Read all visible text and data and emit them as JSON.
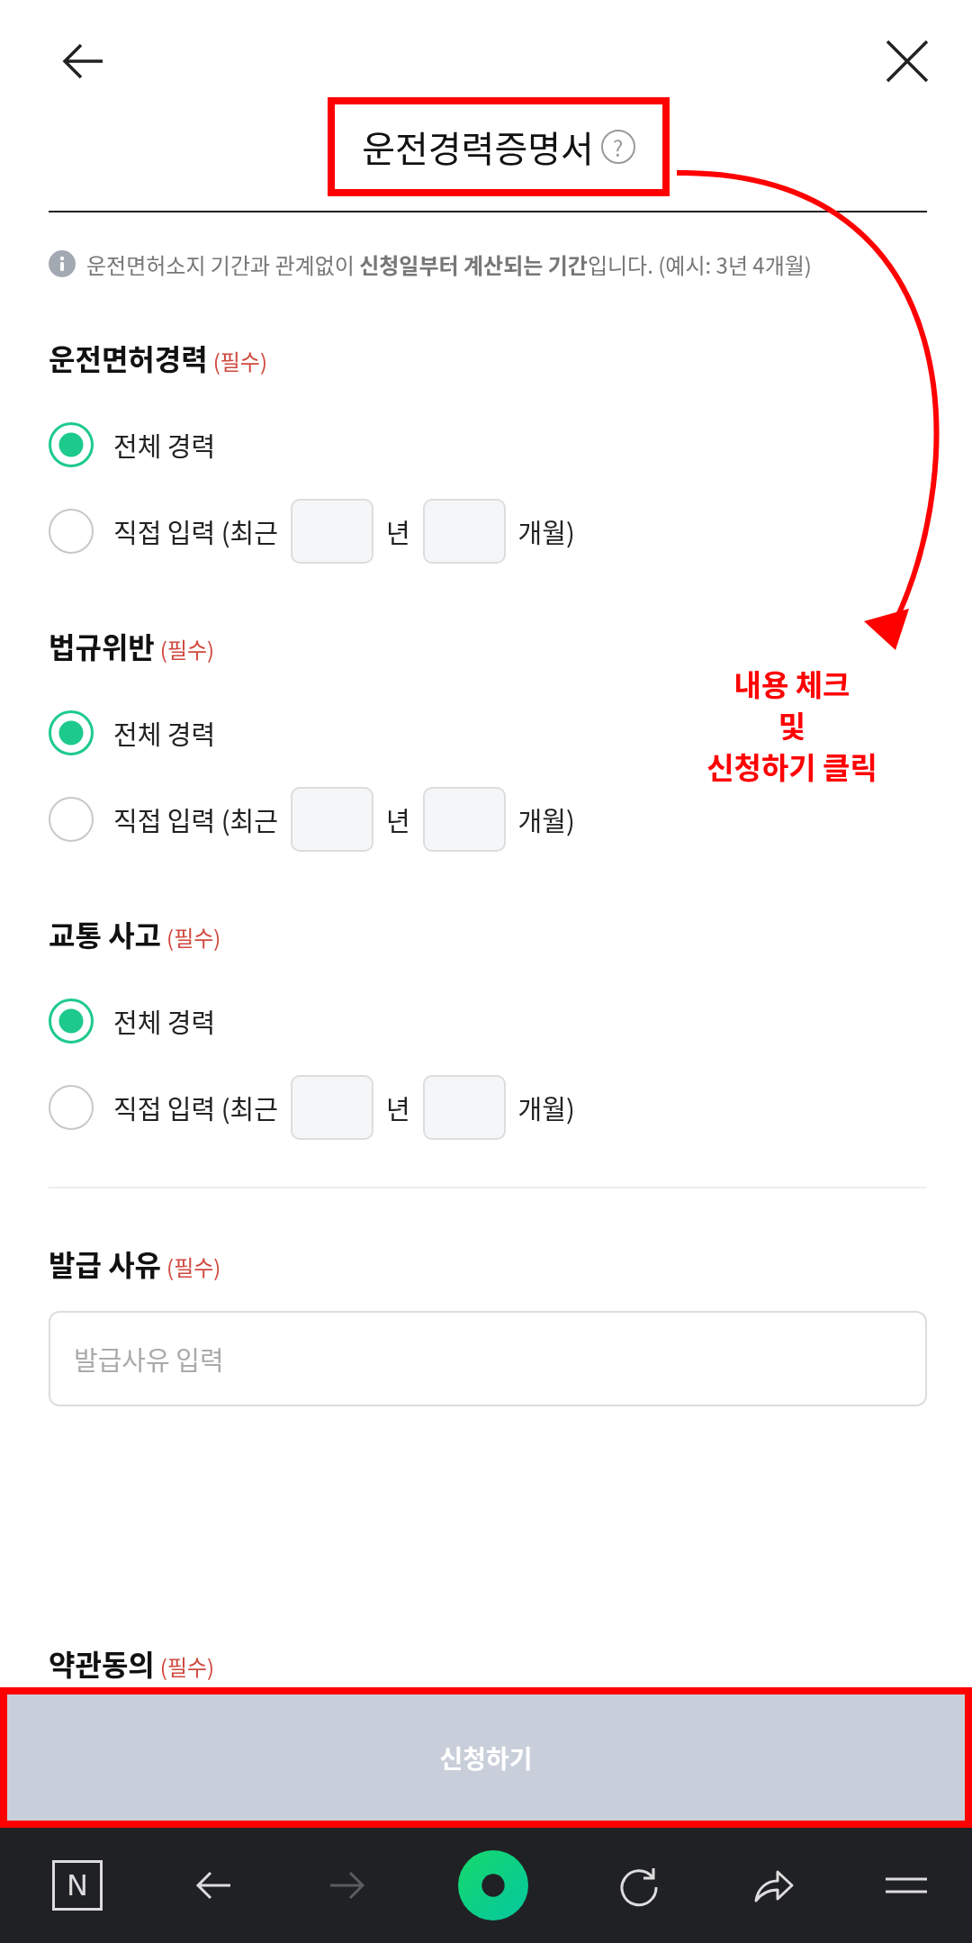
{
  "header": {
    "title": "운전경력증명서",
    "help_icon": "?"
  },
  "info": "운전면허소지 기간과 관계없이 **신청일부터 계산되는 기간**입니다. (예시: 3년 4개월)",
  "sections": [
    {
      "title": "운전면허경력",
      "required": "(필수)",
      "options": [
        {
          "kind": "plain",
          "label": "전체 경력",
          "selected": true
        },
        {
          "kind": "range",
          "label": "직접 입력 (최근",
          "fields": [
            {
              "unit": "년"
            },
            {
              "unit": "개월)"
            }
          ],
          "selected": false
        }
      ]
    },
    {
      "title": "법규위반",
      "required": "(필수)",
      "options": [
        {
          "kind": "plain",
          "label": "전체 경력",
          "selected": true
        },
        {
          "kind": "range",
          "label": "직접 입력 (최근",
          "fields": [
            {
              "unit": "년"
            },
            {
              "unit": "개월)"
            }
          ],
          "selected": false
        }
      ]
    },
    {
      "title": "교통 사고",
      "required": "(필수)",
      "options": [
        {
          "kind": "plain",
          "label": "전체 경력",
          "selected": true
        },
        {
          "kind": "range",
          "label": "직접 입력 (최근",
          "fields": [
            {
              "unit": "년"
            },
            {
              "unit": "개월)"
            }
          ],
          "selected": false
        }
      ]
    }
  ],
  "reason": {
    "title": "발급 사유",
    "required": "(필수)",
    "placeholder": "발급사유 입력"
  },
  "terms": {
    "title": "약관동의",
    "required": "(필수)"
  },
  "submit": {
    "label": "신청하기",
    "disabled": true
  },
  "browser_bar": {
    "home_label": "N",
    "forward_disabled": true
  },
  "annotation": {
    "lines": [
      "내용 체크",
      "및",
      "신청하기 클릭"
    ]
  }
}
